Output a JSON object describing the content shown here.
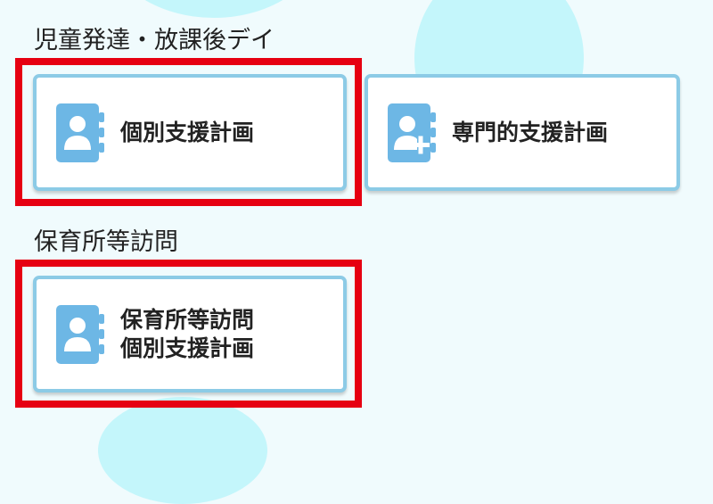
{
  "sections": [
    {
      "heading": "児童発達・放課後デイ",
      "cards": [
        {
          "label": "個別支援計画",
          "icon": "contact-book-icon"
        },
        {
          "label": "専門的支援計画",
          "icon": "contact-book-plus-icon"
        }
      ]
    },
    {
      "heading": "保育所等訪問",
      "cards": [
        {
          "label_line1": "保育所等訪問",
          "label_line2": "個別支援計画",
          "icon": "contact-book-icon"
        }
      ]
    }
  ],
  "colors": {
    "background": "#f0fbfd",
    "blob": "#c4f6fb",
    "highlight": "#e60012",
    "card_border": "#8ccbe6",
    "icon": "#6db7e5"
  }
}
